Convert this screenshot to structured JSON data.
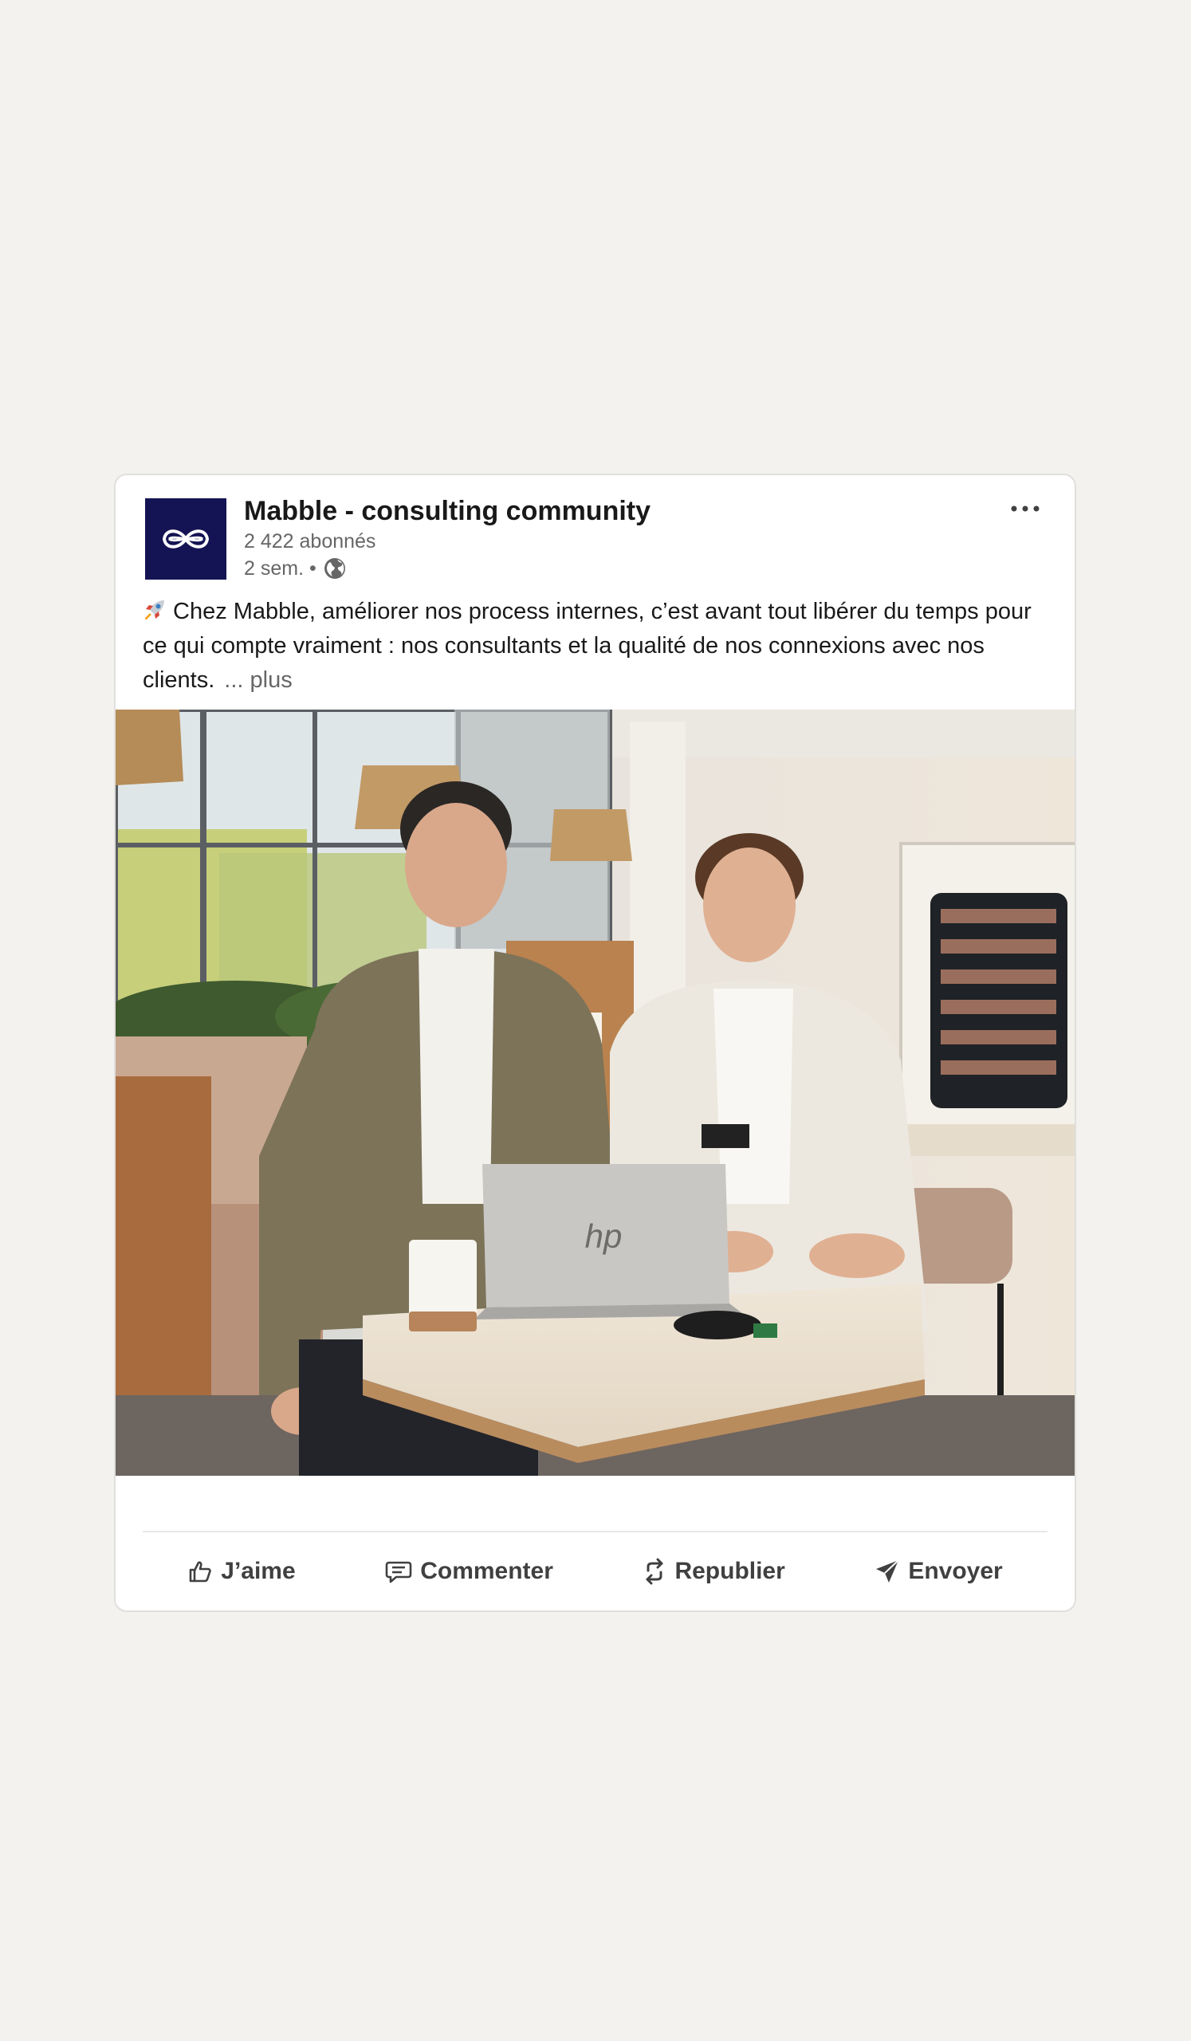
{
  "post": {
    "author": {
      "name": "Mabble - consulting community",
      "followers": "2 422 abonnés",
      "time": "2 sem. •",
      "logo_icon": "infinity-logo-icon",
      "logo_bg": "#141454",
      "visibility_icon": "globe-icon"
    },
    "text": {
      "emoji_icon": "rocket-icon",
      "body": "Chez Mabble, améliorer nos process internes, c’est avant tout libérer du temps pour ce qui compte vraiment : nos consultants et la qualité de nos connexions avec nos clients.",
      "see_more": "... plus"
    },
    "image": {
      "description_icon": "post-photo"
    },
    "actions": [
      {
        "label": "J’aime",
        "icon": "thumbs-up-icon"
      },
      {
        "label": "Commenter",
        "icon": "comment-icon"
      },
      {
        "label": "Republier",
        "icon": "repost-icon"
      },
      {
        "label": "Envoyer",
        "icon": "send-icon"
      }
    ]
  }
}
